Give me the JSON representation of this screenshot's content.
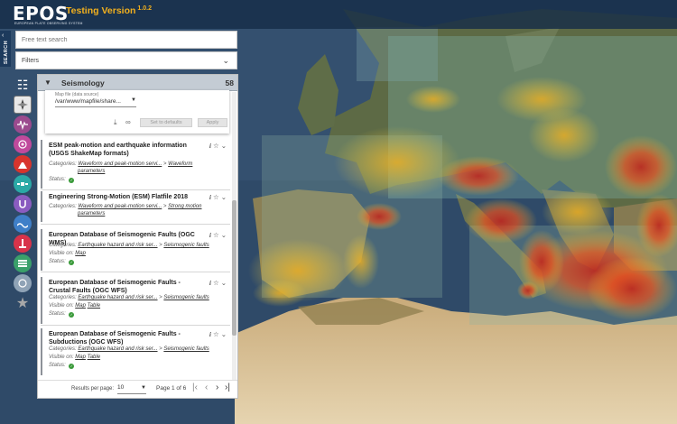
{
  "header": {
    "logo": "EPOS",
    "logo_subtitle": "EUROPEAN PLATE OBSERVING SYSTEM",
    "version_label": "Testing Version",
    "version_number": "1.0.2"
  },
  "search_tab": {
    "label": "SEARCH"
  },
  "search": {
    "placeholder": "Free text search",
    "value": ""
  },
  "filters": {
    "label": "Filters"
  },
  "rail_icons": [
    {
      "name": "grid-menu-icon",
      "color": "#ffffff"
    },
    {
      "name": "compass-icon",
      "color": "#e6e6e6"
    },
    {
      "name": "seismology-icon",
      "color": "#9b4a8e"
    },
    {
      "name": "gnss-icon",
      "color": "#c04a9c"
    },
    {
      "name": "volcano-icon",
      "color": "#d8342c"
    },
    {
      "name": "satellite-icon",
      "color": "#2aa9a6"
    },
    {
      "name": "geomagnetism-icon",
      "color": "#8a5cc0"
    },
    {
      "name": "tsunami-icon",
      "color": "#3f7fc8"
    },
    {
      "name": "anthropogenic-hazards-icon",
      "color": "#d8334a"
    },
    {
      "name": "geological-information-icon",
      "color": "#3aa06a"
    },
    {
      "name": "multi-scale-labs-icon",
      "color": "#8fa3b6"
    },
    {
      "name": "favourites-star-icon",
      "color": "#a8a8a8"
    }
  ],
  "panel": {
    "title": "Seismology",
    "count": "58",
    "settings": {
      "field_label": "Map file (data source)",
      "field_value": "/var/www/mapfile/share...",
      "set_defaults": "Set to defaults",
      "apply": "Apply"
    },
    "items": [
      {
        "title": "ESM peak-motion and earthquake information (USGS ShakeMap formats)",
        "categories_label": "Categories:",
        "cat_a": "Waveform and peak-motion servi...",
        "cat_b": "Waveform",
        "cat_b2": "parameters",
        "status_label": "Status:"
      },
      {
        "title": "Engineering Strong-Motion (ESM) Flatfile 2018",
        "categories_label": "Categories:",
        "cat_a": "Waveform and peak-motion servi...",
        "cat_b": "Strong motion",
        "cat_b2": "parameters",
        "status_label": "Status:"
      },
      {
        "title": "European Database of Seismogenic Faults (OGC WMS)",
        "categories_label": "Categories:",
        "cat_a": "Earthquake hazard and risk ser...",
        "cat_b": "Seismogenic faults",
        "visible_label": "Visible on:",
        "visible_on": [
          "Map"
        ],
        "status_label": "Status:"
      },
      {
        "title": "European Database of Seismogenic Faults - Crustal Faults (OGC WFS)",
        "categories_label": "Categories:",
        "cat_a": "Earthquake hazard and risk ser...",
        "cat_b": "Seismogenic faults",
        "visible_label": "Visible on:",
        "visible_on": [
          "Map",
          "Table"
        ],
        "status_label": "Status:"
      },
      {
        "title": "European Database of Seismogenic Faults - Subductions (OGC WFS)",
        "categories_label": "Categories:",
        "cat_a": "Earthquake hazard and risk ser...",
        "cat_b": "Seismogenic faults",
        "visible_label": "Visible on:",
        "visible_on": [
          "Map",
          "Table"
        ],
        "status_label": "Status:"
      }
    ],
    "pager": {
      "results_per_page_label": "Results per page:",
      "results_per_page": "10",
      "page_of": "Page 1 of 6"
    }
  },
  "colors": {
    "header_bg": "#162d48",
    "accent_orange": "#f2b01e",
    "sea": "#2f4a68",
    "status_ok": "#3a9a3a"
  }
}
